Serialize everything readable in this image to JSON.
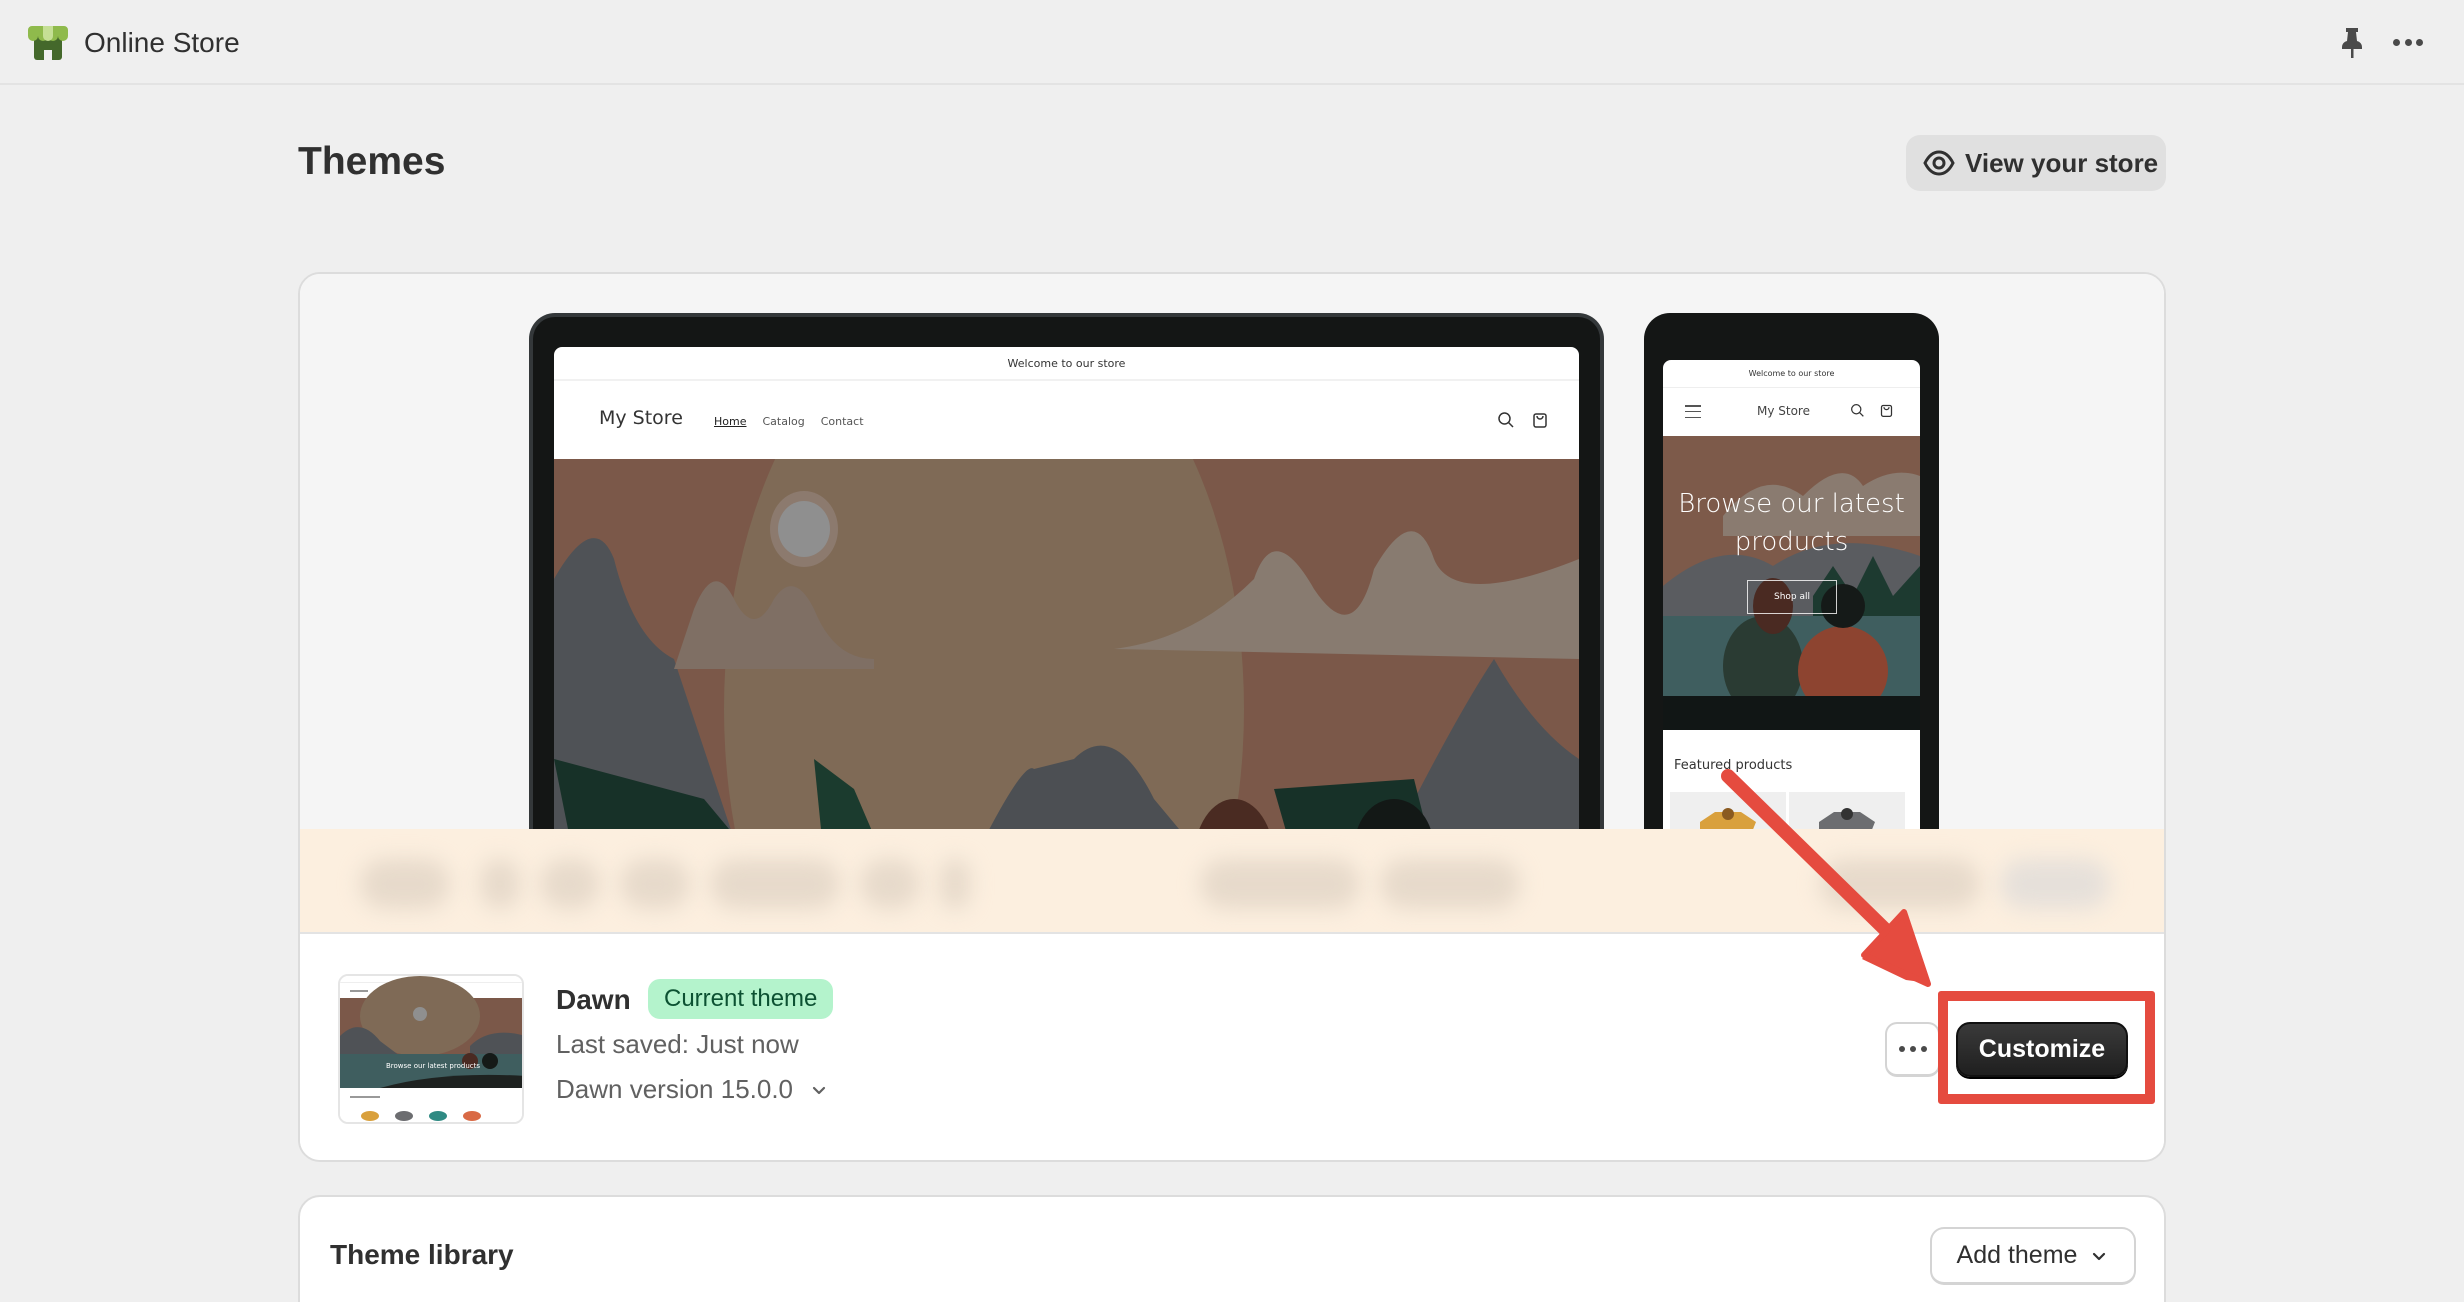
{
  "topbar": {
    "app_title": "Online Store",
    "app_icon": "online-store-icon",
    "pin_icon": "pin-icon",
    "more_icon": "more-horizontal-icon"
  },
  "page": {
    "title": "Themes",
    "view_store_label": "View your store",
    "view_store_icon": "eye-icon"
  },
  "preview": {
    "desktop": {
      "announcement": "Welcome to our store",
      "store_name": "My Store",
      "nav": [
        "Home",
        "Catalog",
        "Contact"
      ],
      "active_nav": "Home"
    },
    "mobile": {
      "announcement": "Welcome to our store",
      "store_name": "My Store",
      "hero_text": "Browse our latest products",
      "hero_button": "Shop all",
      "featured_title": "Featured products"
    }
  },
  "current_theme": {
    "name": "Dawn",
    "badge": "Current theme",
    "last_saved": "Last saved: Just now",
    "version": "Dawn version 15.0.0",
    "thumbnail_text": "Browse our latest products",
    "more_actions_icon": "more-horizontal-icon",
    "customize_label": "Customize"
  },
  "theme_library": {
    "title": "Theme library",
    "add_theme_label": "Add theme"
  },
  "colors": {
    "annotation_red": "#e54b3f",
    "badge_bg": "#b4f3cc",
    "badge_text": "#0c5132",
    "primary_button": "#303030"
  }
}
